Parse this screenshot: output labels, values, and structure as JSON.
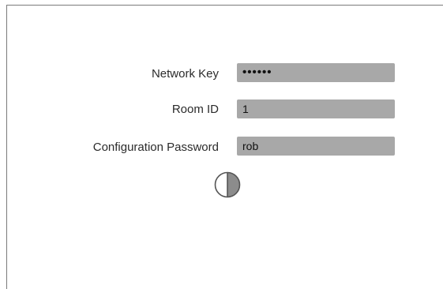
{
  "form": {
    "network_key": {
      "label": "Network Key",
      "value": "••••••"
    },
    "room_id": {
      "label": "Room ID",
      "value": "1"
    },
    "config_password": {
      "label": "Configuration Password",
      "value": "rob"
    },
    "toggle_icon": "half-circle-contrast-icon"
  },
  "colors": {
    "field_background": "#a8a8a8",
    "label_text": "#2b2b2b",
    "border": "#7a7a7a"
  }
}
